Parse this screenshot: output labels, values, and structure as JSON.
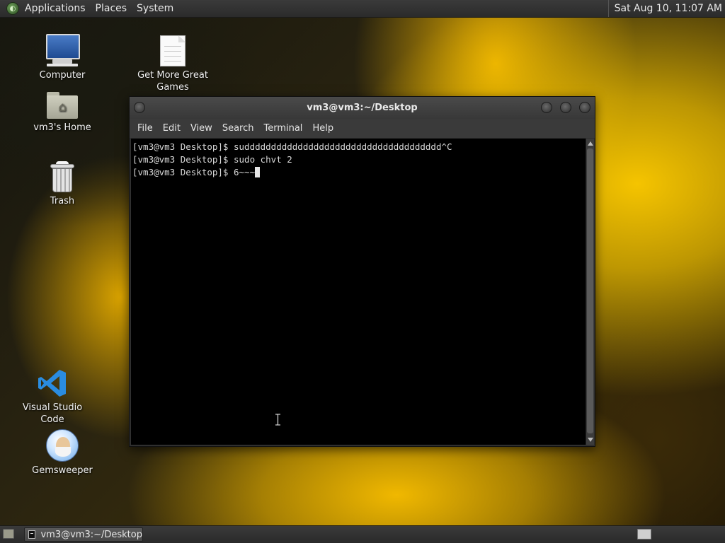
{
  "top_panel": {
    "menus": [
      "Applications",
      "Places",
      "System"
    ],
    "clock": "Sat Aug 10, 11:07 AM"
  },
  "desktop_icons": {
    "computer": {
      "label": "Computer",
      "icon": "computer-icon"
    },
    "games": {
      "label": "Get More Great Games",
      "icon": "document-icon"
    },
    "home": {
      "label": "vm3's Home",
      "icon": "home-folder-icon"
    },
    "trash": {
      "label": "Trash",
      "icon": "trash-icon"
    },
    "vscode": {
      "label": "Visual Studio Code",
      "icon": "vscode-icon"
    },
    "gemsweeper": {
      "label": "Gemsweeper",
      "icon": "gemsweeper-icon"
    }
  },
  "terminal": {
    "title": "vm3@vm3:~/Desktop",
    "menu": [
      "File",
      "Edit",
      "View",
      "Search",
      "Terminal",
      "Help"
    ],
    "lines": [
      "[vm3@vm3 Desktop]$ suddddddddddddddddddddddddddddddddddddd^C",
      "[vm3@vm3 Desktop]$ sudo chvt 2",
      "[vm3@vm3 Desktop]$ 6~~~"
    ]
  },
  "bottom_panel": {
    "task_label": "vm3@vm3:~/Desktop"
  },
  "colors": {
    "panel": "#2e2e2e",
    "terminal_bg": "#000000",
    "terminal_fg": "#d8d8d8",
    "accent_flower": "#f5c400"
  }
}
